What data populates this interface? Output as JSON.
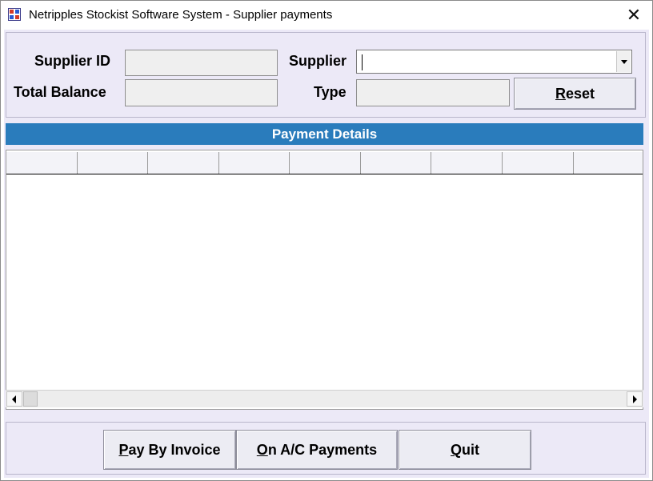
{
  "window": {
    "title": "Netripples Stockist Software System - Supplier payments",
    "close_glyph": "✕"
  },
  "form": {
    "supplier_id_label": "Supplier ID",
    "supplier_id_value": "",
    "total_balance_label": "Total Balance",
    "total_balance_value": "",
    "supplier_label": "Supplier",
    "supplier_value": "",
    "type_label": "Type",
    "type_value": "",
    "reset_button": {
      "mnemonic": "R",
      "rest": "eset"
    }
  },
  "payment_details": {
    "header": "Payment Details",
    "columns": [
      "",
      "",
      "",
      "",
      "",
      "",
      "",
      "",
      ""
    ]
  },
  "actions": {
    "pay_by_invoice": {
      "mnemonic": "P",
      "rest": "ay By Invoice"
    },
    "on_ac_payments": {
      "mnemonic": "O",
      "rest": "n A/C Payments"
    },
    "quit": {
      "mnemonic": "Q",
      "rest": "uit"
    }
  },
  "colors": {
    "client_bg": "#ece9f7",
    "header_bar": "#2a7cbc",
    "field_bg": "#efefef"
  },
  "icons": {
    "app": "app-logo-icon",
    "close": "close-icon",
    "dropdown": "chevron-down-icon",
    "scroll_left": "arrow-left-icon",
    "scroll_right": "arrow-right-icon"
  }
}
